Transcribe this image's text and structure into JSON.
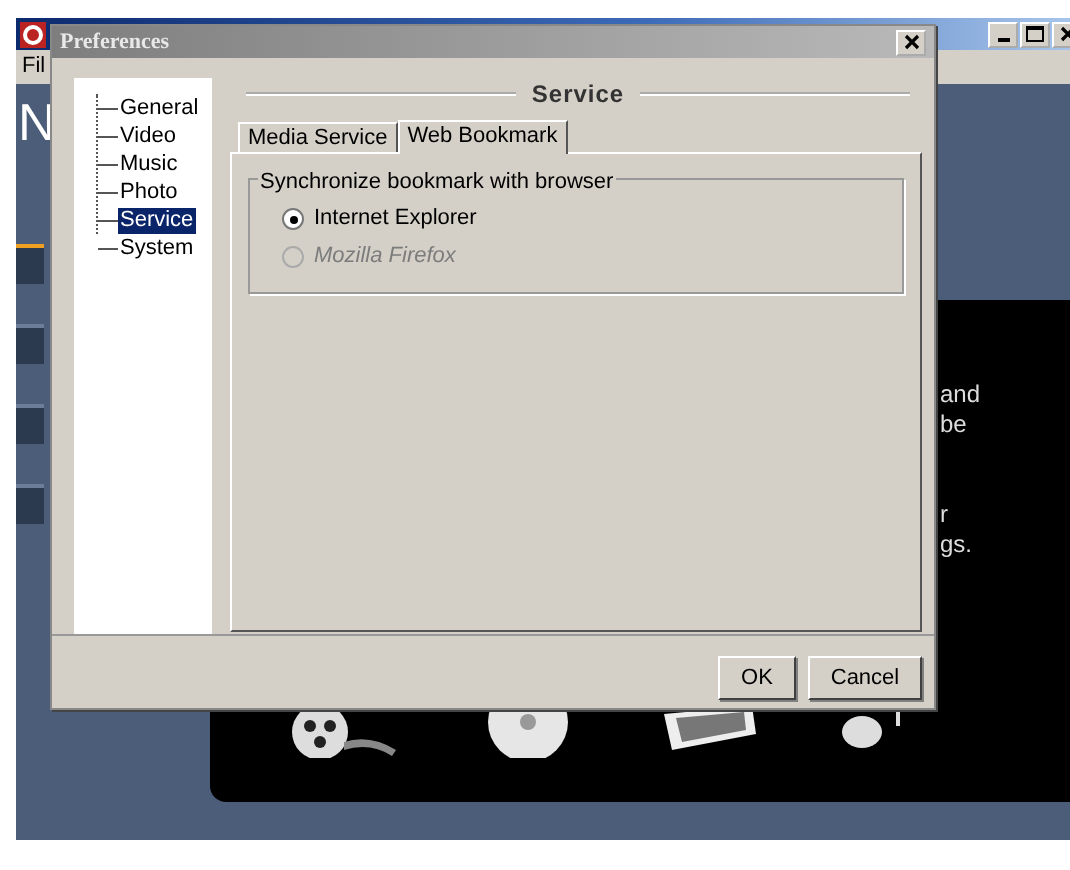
{
  "app": {
    "menu": [
      "Fil"
    ],
    "logo_letter": "N",
    "side_texts": [
      "and",
      "be",
      "r",
      "gs."
    ],
    "sidebar_tabs": [
      {
        "selected": true
      },
      {
        "selected": false
      },
      {
        "selected": false
      },
      {
        "selected": false
      }
    ]
  },
  "dialog": {
    "title": "Preferences",
    "tree": [
      {
        "label": "General",
        "selected": false
      },
      {
        "label": "Video",
        "selected": false
      },
      {
        "label": "Music",
        "selected": false
      },
      {
        "label": "Photo",
        "selected": false
      },
      {
        "label": "Service",
        "selected": true
      },
      {
        "label": "System",
        "selected": false
      }
    ],
    "header": "Service",
    "tabs": [
      {
        "label": "Media Service",
        "selected": false
      },
      {
        "label": "Web Bookmark",
        "selected": true
      }
    ],
    "group": {
      "legend": "Synchronize bookmark with browser",
      "options": [
        {
          "label": "Internet Explorer",
          "checked": true,
          "disabled": false
        },
        {
          "label": "Mozilla Firefox",
          "checked": false,
          "disabled": true
        }
      ]
    },
    "buttons": [
      "OK",
      "Cancel"
    ]
  }
}
